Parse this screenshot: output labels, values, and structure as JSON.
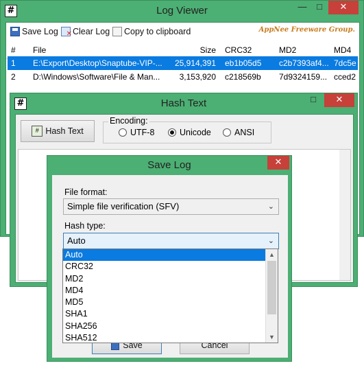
{
  "log_viewer": {
    "title": "Log Viewer",
    "icon_glyph": "#",
    "controls": {
      "minimize": "—",
      "maximize": "□",
      "close": "✕"
    },
    "toolbar": {
      "save_log": "Save Log",
      "clear_log": "Clear Log",
      "copy": "Copy to clipboard"
    },
    "brand": "AppNee Freeware Group.",
    "columns": [
      "#",
      "File",
      "Size",
      "CRC32",
      "MD2",
      "MD4"
    ],
    "rows": [
      {
        "num": "1",
        "file": "E:\\Export\\Desktop\\Snaptube-VIP-...",
        "size": "25,914,391",
        "crc32": "eb1b05d5",
        "md2": "c2b7393af4...",
        "md4": "7dc5e"
      },
      {
        "num": "2",
        "file": "D:\\Windows\\Software\\File & Man...",
        "size": "3,153,920",
        "crc32": "c218569b",
        "md2": "7d9324159...",
        "md4": "cced2"
      }
    ]
  },
  "hash_text": {
    "title": "Hash Text",
    "icon_glyph": "#",
    "hash_button": "Hash Text",
    "encoding_label": "Encoding:",
    "encodings": [
      "UTF-8",
      "Unicode",
      "ANSI"
    ],
    "selected_encoding": "Unicode"
  },
  "save_log": {
    "title": "Save Log",
    "close": "✕",
    "file_format_label": "File format:",
    "file_format_value": "Simple file verification (SFV)",
    "hash_type_label": "Hash type:",
    "hash_type_value": "Auto",
    "options": [
      "Auto",
      "CRC32",
      "MD2",
      "MD4",
      "MD5",
      "SHA1",
      "SHA256",
      "SHA512"
    ],
    "selected_option": "Auto",
    "save_button": "Save",
    "cancel_button": "Cancel"
  },
  "colors": {
    "accent": "#4caf73",
    "selection": "#0a7be0",
    "close": "#c7403a"
  }
}
